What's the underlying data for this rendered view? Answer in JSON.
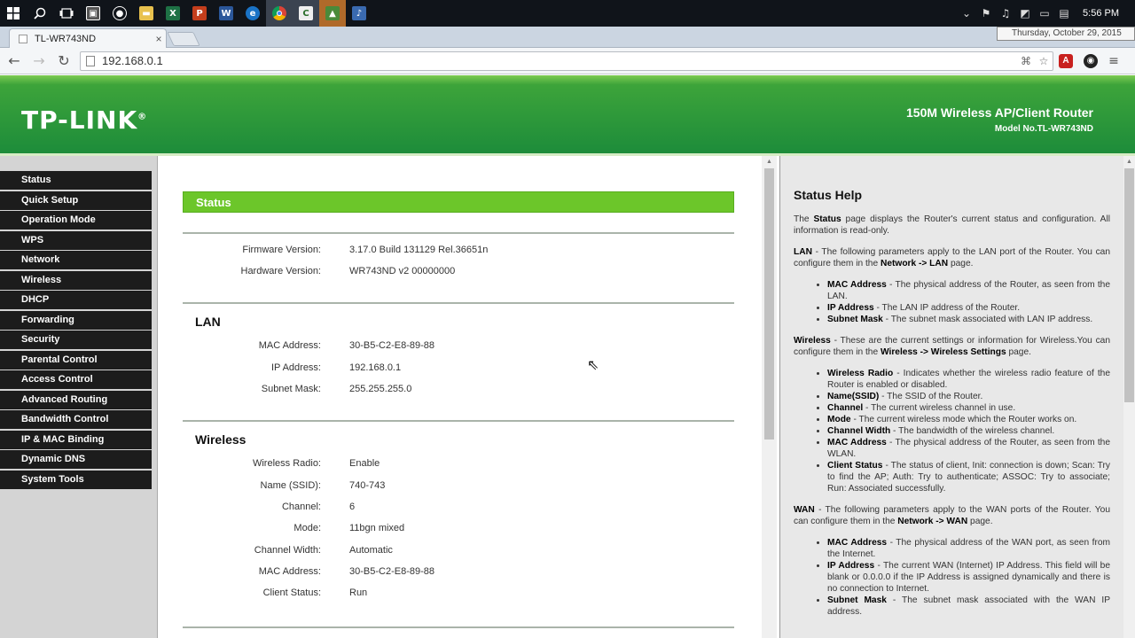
{
  "taskbar": {
    "clock": "5:56 PM",
    "date_tooltip": "Thursday, October 29, 2015"
  },
  "browser": {
    "tab_title": "TL-WR743ND",
    "tab_close": "×",
    "url": "192.168.0.1"
  },
  "header": {
    "logo": "TP-LINK",
    "product": "150M Wireless AP/Client Router",
    "model": "Model No.TL-WR743ND"
  },
  "menu": [
    "Status",
    "Quick Setup",
    "Operation Mode",
    "WPS",
    "Network",
    "Wireless",
    "DHCP",
    "Forwarding",
    "Security",
    "Parental Control",
    "Access Control",
    "Advanced Routing",
    "Bandwidth Control",
    "IP & MAC Binding",
    "Dynamic DNS",
    "System Tools"
  ],
  "status": {
    "heading": "Status",
    "firmware_label": "Firmware Version:",
    "firmware_value": "3.17.0 Build 131129 Rel.36651n",
    "hardware_label": "Hardware Version:",
    "hardware_value": "WR743ND v2 00000000",
    "lan": {
      "title": "LAN",
      "mac_label": "MAC Address:",
      "mac_value": "30-B5-C2-E8-89-88",
      "ip_label": "IP Address:",
      "ip_value": "192.168.0.1",
      "mask_label": "Subnet Mask:",
      "mask_value": "255.255.255.0"
    },
    "wireless": {
      "title": "Wireless",
      "radio_label": "Wireless Radio:",
      "radio_value": "Enable",
      "ssid_label": "Name (SSID):",
      "ssid_value": "740-743",
      "channel_label": "Channel:",
      "channel_value": "6",
      "mode_label": "Mode:",
      "mode_value": "11bgn mixed",
      "width_label": "Channel Width:",
      "width_value": "Automatic",
      "mac_label": "MAC Address:",
      "mac_value": "30-B5-C2-E8-89-88",
      "client_label": "Client Status:",
      "client_value": "Run"
    }
  },
  "help": {
    "title": "Status Help",
    "intro_1": "The ",
    "intro_b": "Status",
    "intro_2": " page displays the Router's current status and configuration. All information is read-only.",
    "lan_b": "LAN",
    "lan_text": " - The following parameters apply to the LAN port of the Router. You can configure them in the ",
    "lan_link": "Network -> LAN",
    "lan_end": " page.",
    "lan_items": [
      {
        "b": "MAC Address",
        "t": " - The physical address of the Router, as seen from the LAN."
      },
      {
        "b": "IP Address",
        "t": " - The LAN IP address of the Router."
      },
      {
        "b": "Subnet Mask",
        "t": " - The subnet mask associated with LAN IP address."
      }
    ],
    "wl_b": "Wireless",
    "wl_text": " - These are the current settings or information for Wireless.You can configure them in the ",
    "wl_link": "Wireless -> Wireless Settings",
    "wl_end": " page.",
    "wl_items": [
      {
        "b": "Wireless Radio",
        "t": " - Indicates whether the wireless radio feature of the Router is enabled or disabled."
      },
      {
        "b": "Name(SSID)",
        "t": " - The SSID of the Router."
      },
      {
        "b": "Channel",
        "t": " - The current wireless channel in use."
      },
      {
        "b": "Mode",
        "t": " - The current wireless mode which the Router works on."
      },
      {
        "b": "Channel Width",
        "t": " - The bandwidth of the wireless channel."
      },
      {
        "b": "MAC Address",
        "t": " - The physical address of the Router, as seen from the WLAN."
      },
      {
        "b": "Client Status",
        "t": " - The status of client, Init: connection is down; Scan: Try to find the AP; Auth: Try to authenticate; ASSOC: Try to associate; Run: Associated successfully."
      }
    ],
    "wan_b": "WAN",
    "wan_text": " - The following parameters apply to the WAN ports of the Router. You can configure them in the ",
    "wan_link": "Network -> WAN",
    "wan_end": " page.",
    "wan_items": [
      {
        "b": "MAC Address",
        "t": " - The physical address of the WAN port, as seen from the Internet."
      },
      {
        "b": "IP Address",
        "t": " - The current WAN (Internet) IP Address. This field will be blank or 0.0.0.0 if the IP Address is assigned dynamically and there is no connection to Internet."
      },
      {
        "b": "Subnet Mask",
        "t": " - The subnet mask associated with the WAN IP address."
      }
    ]
  },
  "icons": [
    "windows-icon",
    "search-icon",
    "task-view-icon",
    "store-icon",
    "chrome-icon",
    "back-icon",
    "forward-icon",
    "reload-icon",
    "star-icon",
    "cursor-icon"
  ]
}
